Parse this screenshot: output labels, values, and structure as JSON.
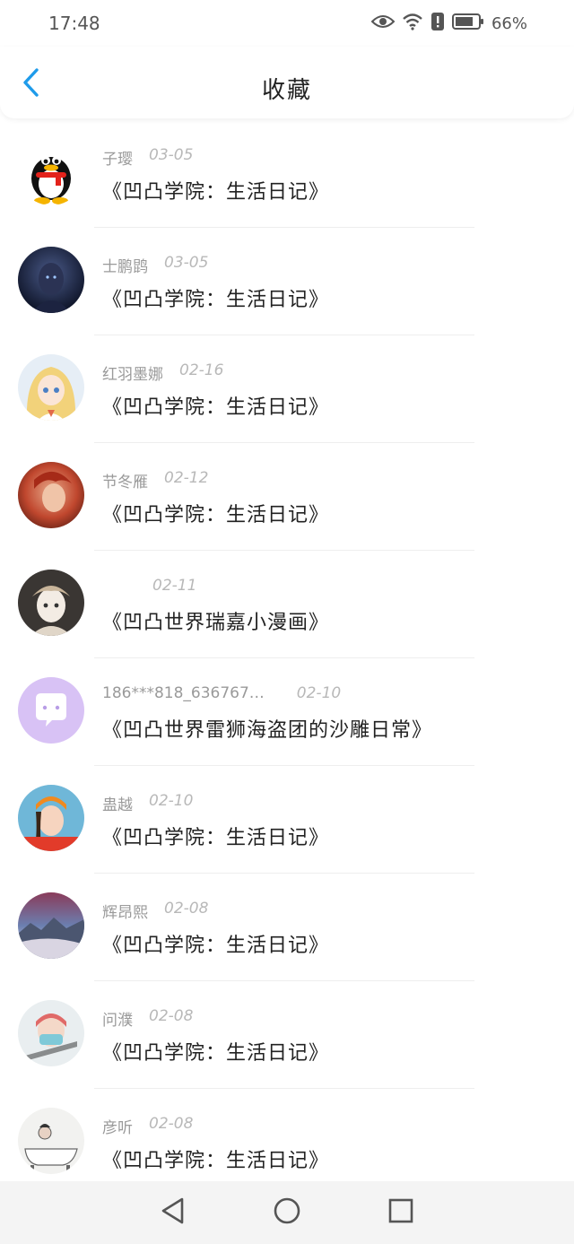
{
  "status": {
    "time": "17:48",
    "battery_text": "66%",
    "icons": [
      "eye-icon",
      "wifi-icon",
      "alert-icon",
      "battery-icon"
    ]
  },
  "header": {
    "title": "收藏",
    "back_icon": "chevron-left-icon",
    "accent_color": "#1E9BEA"
  },
  "items": [
    {
      "author": "子璎",
      "date": "03-05",
      "title": "《凹凸学院：生活日记》",
      "avatar": "qq-penguin"
    },
    {
      "author": "士鹏鹍",
      "date": "03-05",
      "title": "《凹凸学院：生活日记》",
      "avatar": "dark-hero"
    },
    {
      "author": "红羽墨娜",
      "date": "02-16",
      "title": "《凹凸学院：生活日记》",
      "avatar": "blonde-anime"
    },
    {
      "author": "节冬雁",
      "date": "02-12",
      "title": "《凹凸学院：生活日记》",
      "avatar": "red-hair"
    },
    {
      "author": "",
      "date": "02-11",
      "title": "《凹凸世界瑞嘉小漫画》",
      "avatar": "sketch-girl"
    },
    {
      "author": "186***818_636767…",
      "date": "02-10",
      "title": "《凹凸世界雷狮海盗团的沙雕日常》",
      "avatar": "default-chat"
    },
    {
      "author": "蛊越",
      "date": "02-10",
      "title": "《凹凸学院：生活日记》",
      "avatar": "girl-photo"
    },
    {
      "author": "辉昂熙",
      "date": "02-08",
      "title": "《凹凸学院：生活日记》",
      "avatar": "landscape"
    },
    {
      "author": "问濮",
      "date": "02-08",
      "title": "《凹凸学院：生活日记》",
      "avatar": "masked-person"
    },
    {
      "author": "彦听",
      "date": "02-08",
      "title": "《凹凸学院：生活日记》",
      "avatar": "bathtub-sketch"
    }
  ],
  "nav": {
    "back_icon": "triangle-back-icon",
    "home_icon": "circle-home-icon",
    "recent_icon": "square-recent-icon"
  }
}
